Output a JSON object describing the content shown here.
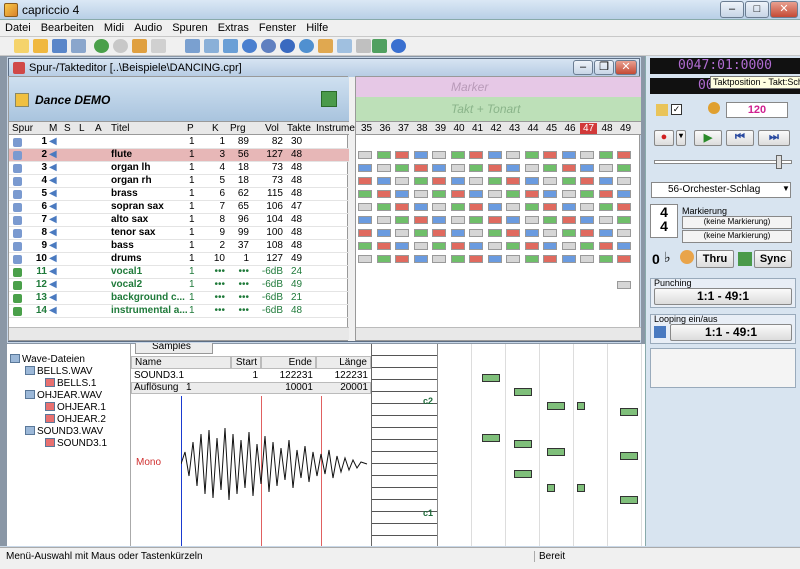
{
  "window": {
    "title": "capriccio 4"
  },
  "menu": [
    "Datei",
    "Bearbeiten",
    "Midi",
    "Audio",
    "Spuren",
    "Extras",
    "Fenster",
    "Hilfe"
  ],
  "editor": {
    "title": "Spur-/Takteditor [..\\Beispiele\\DANCING.cpr]",
    "song_name": "Dance DEMO",
    "columns": [
      "Spur",
      "M",
      "S",
      "L",
      "A",
      "Titel",
      "P",
      "K",
      "Prg",
      "Vol",
      "Takte",
      "Instrumen"
    ],
    "tracks": [
      {
        "num": "1",
        "title": "",
        "p": "1",
        "k": "1",
        "prg": "89",
        "vol": "82",
        "takte": "30",
        "type": "midi"
      },
      {
        "num": "2",
        "title": "flute",
        "p": "1",
        "k": "3",
        "prg": "56",
        "vol": "127",
        "takte": "48",
        "type": "midi",
        "selected": true
      },
      {
        "num": "3",
        "title": "organ lh",
        "p": "1",
        "k": "4",
        "prg": "18",
        "vol": "73",
        "takte": "48",
        "type": "midi"
      },
      {
        "num": "4",
        "title": "organ rh",
        "p": "1",
        "k": "5",
        "prg": "18",
        "vol": "73",
        "takte": "48",
        "type": "midi"
      },
      {
        "num": "5",
        "title": "brass",
        "p": "1",
        "k": "6",
        "prg": "62",
        "vol": "115",
        "takte": "48",
        "type": "midi"
      },
      {
        "num": "6",
        "title": "sopran sax",
        "p": "1",
        "k": "7",
        "prg": "65",
        "vol": "106",
        "takte": "47",
        "type": "midi"
      },
      {
        "num": "7",
        "title": "alto sax",
        "p": "1",
        "k": "8",
        "prg": "96",
        "vol": "104",
        "takte": "48",
        "type": "midi"
      },
      {
        "num": "8",
        "title": "tenor sax",
        "p": "1",
        "k": "9",
        "prg": "99",
        "vol": "100",
        "takte": "48",
        "type": "midi"
      },
      {
        "num": "9",
        "title": "bass",
        "p": "1",
        "k": "2",
        "prg": "37",
        "vol": "108",
        "takte": "48",
        "type": "midi"
      },
      {
        "num": "10",
        "title": "drums",
        "p": "1",
        "k": "10",
        "prg": "1",
        "vol": "127",
        "takte": "49",
        "type": "midi"
      },
      {
        "num": "11",
        "title": "vocal1",
        "p": "1",
        "k": "•••",
        "prg": "•••",
        "vol": "-6dB",
        "takte": "24",
        "type": "audio"
      },
      {
        "num": "12",
        "title": "vocal2",
        "p": "1",
        "k": "•••",
        "prg": "•••",
        "vol": "-6dB",
        "takte": "49",
        "type": "audio"
      },
      {
        "num": "13",
        "title": "background c...",
        "p": "1",
        "k": "•••",
        "prg": "•••",
        "vol": "-6dB",
        "takte": "21",
        "type": "audio"
      },
      {
        "num": "14",
        "title": "instrumental a...",
        "p": "1",
        "k": "•••",
        "prg": "•••",
        "vol": "-6dB",
        "takte": "48",
        "type": "audio"
      }
    ],
    "marker_label": "Marker",
    "takt_label": "Takt + Tonart",
    "bars": [
      "35",
      "36",
      "37",
      "38",
      "39",
      "40",
      "41",
      "42",
      "43",
      "44",
      "45",
      "46",
      "47",
      "48",
      "49"
    ],
    "current_bar": "47"
  },
  "right": {
    "time_top": "0047:01:0000",
    "time_second": "00:0",
    "tooltip": "Taktposition - Takt:Schlag",
    "tempo": "120",
    "instrument": "56-Orchester-Schlag",
    "markierung_label": "Markierung",
    "marker1": "(keine Markierung)",
    "marker2": "(keine Markierung)",
    "thru": "Thru",
    "sync": "Sync",
    "time_sig_top": "4",
    "time_sig_bottom": "4",
    "key_sig": "0",
    "punching_label": "Punching",
    "punching_range": "1:1 - 49:1",
    "looping_label": "Looping ein/aus",
    "looping_range": "1:1 - 49:1"
  },
  "wave": {
    "root": "Wave-Dateien",
    "items": [
      {
        "label": "BELLS.WAV",
        "indent": 1
      },
      {
        "label": "BELLS.1",
        "indent": 2
      },
      {
        "label": "OHJEAR.WAV",
        "indent": 1
      },
      {
        "label": "OHJEAR.1",
        "indent": 2
      },
      {
        "label": "OHJEAR.2",
        "indent": 2
      },
      {
        "label": "SOUND3.WAV",
        "indent": 1
      },
      {
        "label": "SOUND3.1",
        "indent": 2
      }
    ],
    "samples_label": "Samples",
    "info_headers": [
      "Name",
      "Start",
      "Ende",
      "Länge"
    ],
    "row1": [
      "SOUND3.1",
      "1",
      "122231",
      "122231"
    ],
    "row2": [
      "Auflösung",
      "1",
      "10001",
      "20001"
    ],
    "mono_label": "Mono"
  },
  "piano": {
    "c2": "c2",
    "c1": "c1"
  },
  "status": {
    "left": "Menü-Auswahl mit Maus oder Tastenkürzeln",
    "right": "Bereit"
  }
}
